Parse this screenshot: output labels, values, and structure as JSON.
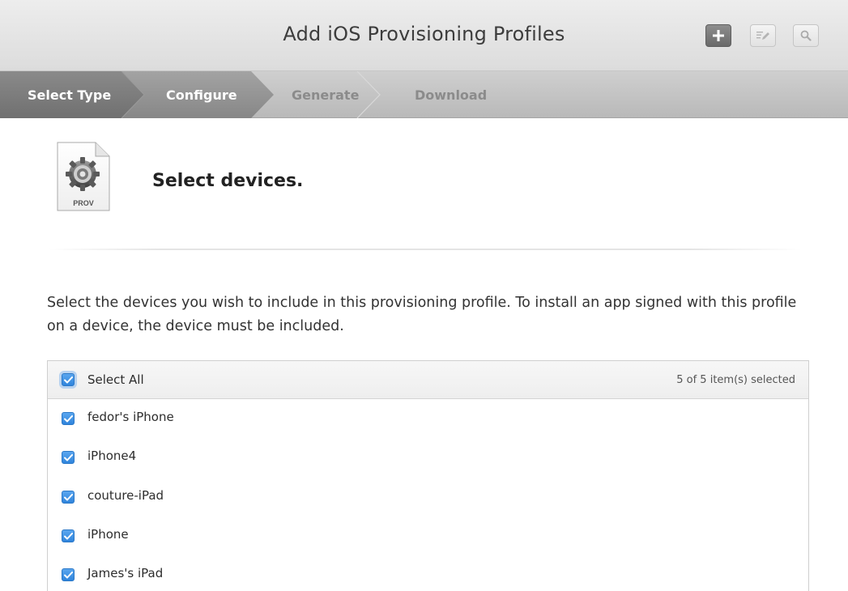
{
  "header": {
    "title": "Add iOS Provisioning Profiles",
    "add_button_icon": "plus-icon",
    "edit_button_icon": "edit-icon",
    "search_button_icon": "search-icon"
  },
  "steps": [
    {
      "label": "Select Type",
      "state": "done"
    },
    {
      "label": "Configure",
      "state": "current"
    },
    {
      "label": "Generate",
      "state": "todo"
    },
    {
      "label": "Download",
      "state": "todo"
    }
  ],
  "content": {
    "icon_label": "PROV",
    "heading": "Select devices.",
    "description": "Select the devices you wish to include in this provisioning profile. To install an app signed with this profile on a device, the device must be included."
  },
  "device_list": {
    "select_all_label": "Select All",
    "select_all_checked": true,
    "count_text": "5  of 5 item(s) selected",
    "devices": [
      {
        "name": "fedor's iPhone",
        "checked": true
      },
      {
        "name": "iPhone4",
        "checked": true
      },
      {
        "name": "couture-iPad",
        "checked": true
      },
      {
        "name": "iPhone",
        "checked": true
      },
      {
        "name": "James's iPad",
        "checked": true
      }
    ]
  },
  "colors": {
    "checkbox_blue": "#2f84dc",
    "step_done_bg": "#7e7e7e",
    "step_current_bg": "#959595"
  }
}
